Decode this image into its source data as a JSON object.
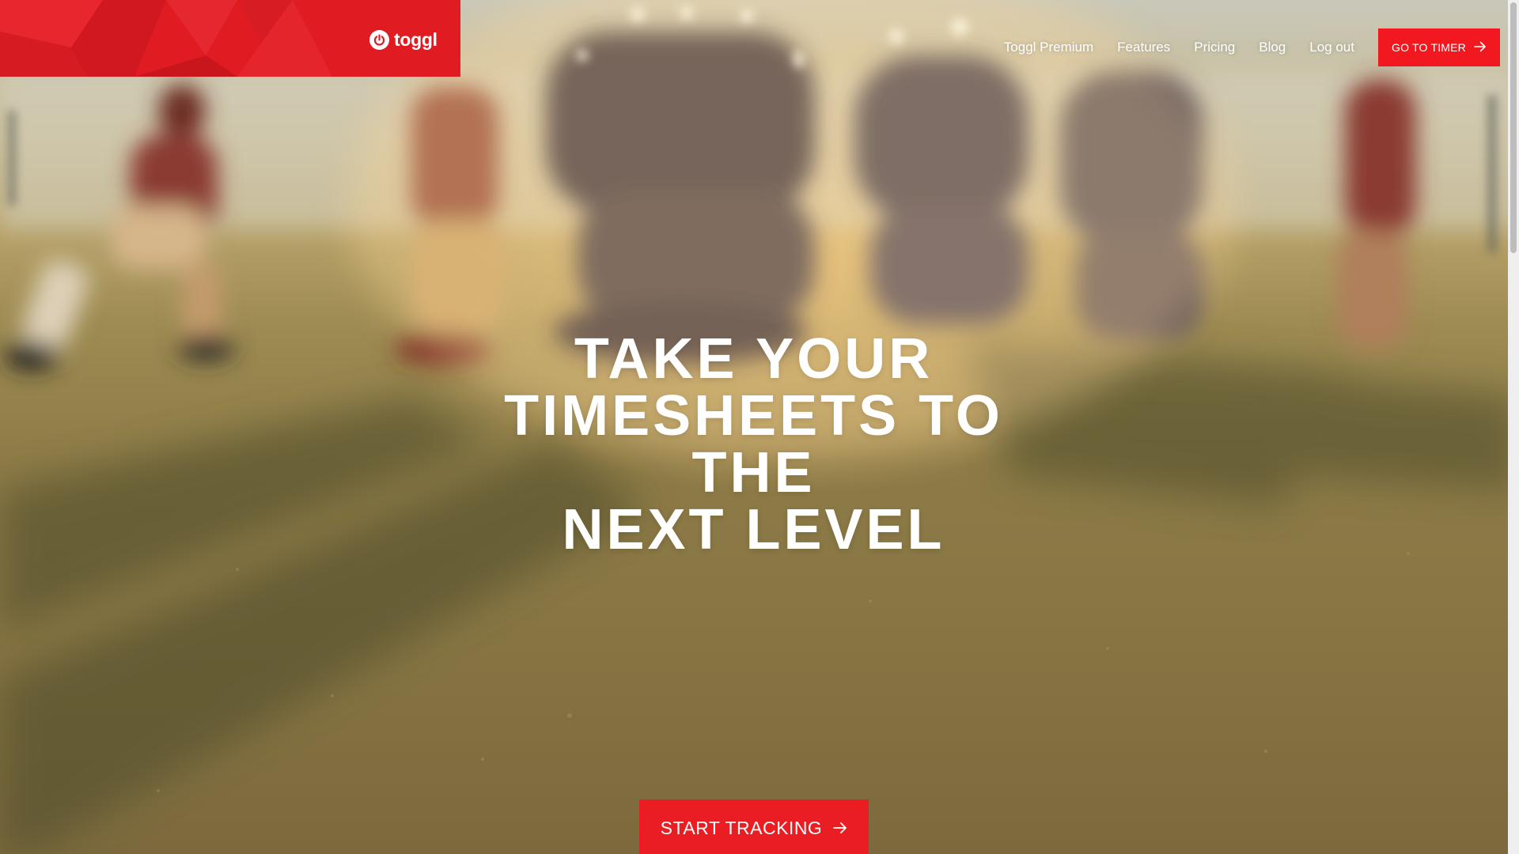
{
  "brand": {
    "logo_text": "toggl",
    "logo_icon": "power-icon",
    "primary_color": "#e01b22",
    "button_color": "#f1191f"
  },
  "nav": {
    "items": [
      {
        "label": "Toggl Premium"
      },
      {
        "label": "Features"
      },
      {
        "label": "Pricing"
      },
      {
        "label": "Blog"
      },
      {
        "label": "Log out"
      }
    ],
    "timer_button": {
      "label": "GO TO TIMER",
      "icon": "arrow-right-icon"
    }
  },
  "hero": {
    "title_lines": [
      "TAKE YOUR",
      "TIMESHEETS TO THE",
      "NEXT LEVEL"
    ],
    "cta_label": "START TRACKING",
    "cta_icon": "arrow-right-icon",
    "background": "blurred-american-football-players-on-field-photo"
  }
}
